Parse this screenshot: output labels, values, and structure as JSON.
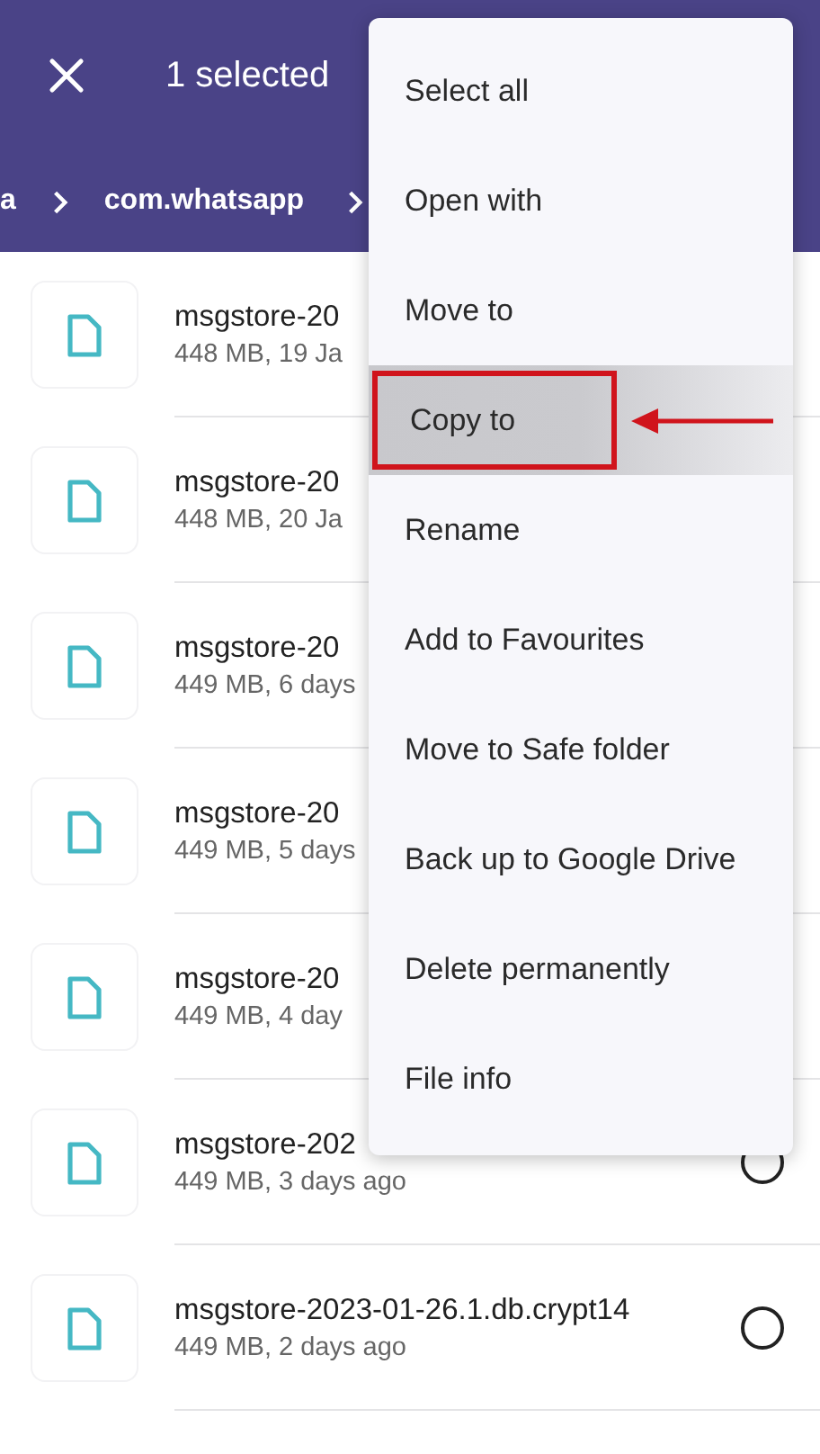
{
  "header": {
    "title": "1 selected"
  },
  "breadcrumb": [
    "a",
    "com.whatsapp"
  ],
  "files": [
    {
      "name": "msgstore-20",
      "meta": "448 MB, 19 Ja"
    },
    {
      "name": "msgstore-20",
      "meta": "448 MB, 20 Ja"
    },
    {
      "name": "msgstore-20",
      "meta": "449 MB, 6 days"
    },
    {
      "name": "msgstore-20",
      "meta": "449 MB, 5 days"
    },
    {
      "name": "msgstore-20",
      "meta": "449 MB, 4 day"
    },
    {
      "name": "msgstore-202",
      "meta": "449 MB, 3 days ago",
      "selected": false
    },
    {
      "name": "msgstore-2023-01-26.1.db.crypt14",
      "meta": "449 MB, 2 days ago",
      "selected": false
    }
  ],
  "menu": [
    {
      "label": "Select all",
      "highlighted": false
    },
    {
      "label": "Open with",
      "highlighted": false
    },
    {
      "label": "Move to",
      "highlighted": false
    },
    {
      "label": "Copy to",
      "highlighted": true
    },
    {
      "label": "Rename",
      "highlighted": false
    },
    {
      "label": "Add to Favourites",
      "highlighted": false
    },
    {
      "label": "Move to Safe folder",
      "highlighted": false
    },
    {
      "label": "Back up to Google Drive",
      "highlighted": false
    },
    {
      "label": "Delete permanently",
      "highlighted": false
    },
    {
      "label": "File info",
      "highlighted": false
    }
  ]
}
